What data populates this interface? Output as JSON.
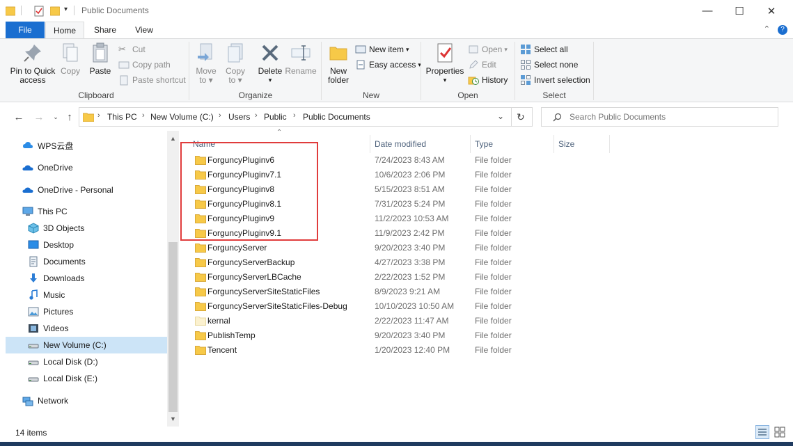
{
  "window": {
    "title": "Public Documents",
    "minimize": "—",
    "maximize": "☐",
    "close": "✕"
  },
  "ribbon_tabs": [
    "File",
    "Home",
    "Share",
    "View"
  ],
  "ribbon": {
    "clipboard": {
      "label": "Clipboard",
      "pin": "Pin to Quick",
      "pin2": "access",
      "copy": "Copy",
      "paste": "Paste",
      "cut": "Cut",
      "copy_path": "Copy path",
      "paste_shortcut": "Paste shortcut"
    },
    "organize": {
      "label": "Organize",
      "move": "Move",
      "move2": "to",
      "copy": "Copy",
      "copy2": "to",
      "delete": "Delete",
      "rename": "Rename"
    },
    "new": {
      "label": "New",
      "new_folder": "New",
      "new_folder2": "folder",
      "new_item": "New item",
      "easy_access": "Easy access"
    },
    "open": {
      "label": "Open",
      "properties": "Properties",
      "open": "Open",
      "edit": "Edit",
      "history": "History"
    },
    "select": {
      "label": "Select",
      "select_all": "Select all",
      "select_none": "Select none",
      "invert": "Invert selection"
    }
  },
  "address": {
    "crumbs": [
      "This PC",
      "New Volume (C:)",
      "Users",
      "Public",
      "Public Documents"
    ]
  },
  "search": {
    "placeholder": "Search Public Documents"
  },
  "nav_pane": [
    {
      "label": "WPS云盘",
      "icon": "wps-cloud-icon"
    },
    {
      "label": "OneDrive",
      "icon": "onedrive-icon"
    },
    {
      "label": "OneDrive - Personal",
      "icon": "onedrive-icon"
    },
    {
      "label": "This PC",
      "icon": "computer-icon"
    },
    {
      "label": "3D Objects",
      "icon": "3d-objects-icon"
    },
    {
      "label": "Desktop",
      "icon": "desktop-icon"
    },
    {
      "label": "Documents",
      "icon": "documents-icon"
    },
    {
      "label": "Downloads",
      "icon": "downloads-icon"
    },
    {
      "label": "Music",
      "icon": "music-icon"
    },
    {
      "label": "Pictures",
      "icon": "pictures-icon"
    },
    {
      "label": "Videos",
      "icon": "videos-icon"
    },
    {
      "label": "New Volume (C:)",
      "icon": "drive-icon",
      "selected": true
    },
    {
      "label": "Local Disk (D:)",
      "icon": "drive-icon"
    },
    {
      "label": "Local Disk (E:)",
      "icon": "drive-icon"
    },
    {
      "label": "Network",
      "icon": "network-icon"
    }
  ],
  "columns": {
    "name": "Name",
    "date": "Date modified",
    "type": "Type",
    "size": "Size"
  },
  "files": [
    {
      "name": "ForguncyPluginv6",
      "date": "7/24/2023 8:43 AM",
      "type": "File folder"
    },
    {
      "name": "ForguncyPluginv7.1",
      "date": "10/6/2023 2:06 PM",
      "type": "File folder"
    },
    {
      "name": "ForguncyPluginv8",
      "date": "5/15/2023 8:51 AM",
      "type": "File folder"
    },
    {
      "name": "ForguncyPluginv8.1",
      "date": "7/31/2023 5:24 PM",
      "type": "File folder"
    },
    {
      "name": "ForguncyPluginv9",
      "date": "11/2/2023 10:53 AM",
      "type": "File folder"
    },
    {
      "name": "ForguncyPluginv9.1",
      "date": "11/9/2023 2:42 PM",
      "type": "File folder"
    },
    {
      "name": "ForguncyServer",
      "date": "9/20/2023 3:40 PM",
      "type": "File folder"
    },
    {
      "name": "ForguncyServerBackup",
      "date": "4/27/2023 3:38 PM",
      "type": "File folder"
    },
    {
      "name": "ForguncyServerLBCache",
      "date": "2/22/2023 1:52 PM",
      "type": "File folder"
    },
    {
      "name": "ForguncyServerSiteStaticFiles",
      "date": "8/9/2023 9:21 AM",
      "type": "File folder"
    },
    {
      "name": "ForguncyServerSiteStaticFiles-Debug",
      "date": "10/10/2023 10:50 AM",
      "type": "File folder"
    },
    {
      "name": "kernal",
      "date": "2/22/2023 11:47 AM",
      "type": "File folder",
      "faded": true
    },
    {
      "name": "PublishTemp",
      "date": "9/20/2023 3:40 PM",
      "type": "File folder"
    },
    {
      "name": "Tencent",
      "date": "1/20/2023 12:40 PM",
      "type": "File folder"
    }
  ],
  "status": {
    "count": "14 items"
  },
  "colors": {
    "accent": "#1a6ed0",
    "selection": "#cce4f7",
    "highlight_box": "#e03c3c",
    "folder": "#f7c948"
  }
}
